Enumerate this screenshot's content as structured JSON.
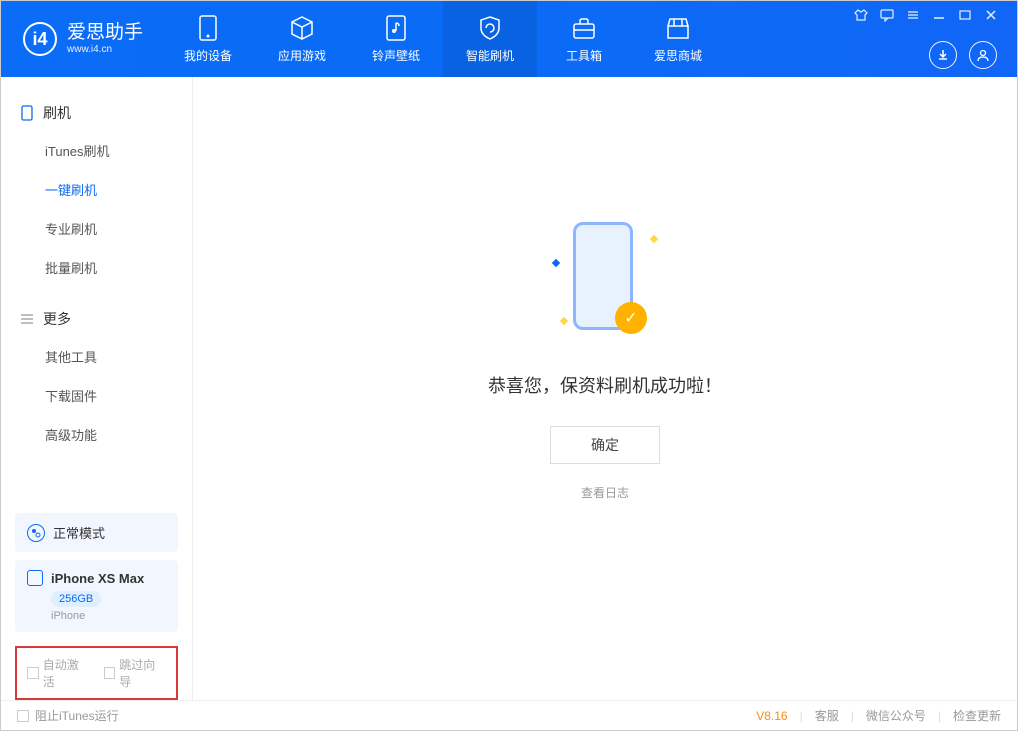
{
  "app": {
    "name": "爱思助手",
    "url": "www.i4.cn"
  },
  "nav": {
    "items": [
      {
        "label": "我的设备"
      },
      {
        "label": "应用游戏"
      },
      {
        "label": "铃声壁纸"
      },
      {
        "label": "智能刷机"
      },
      {
        "label": "工具箱"
      },
      {
        "label": "爱思商城"
      }
    ]
  },
  "sidebar": {
    "section1": {
      "title": "刷机"
    },
    "items1": [
      {
        "label": "iTunes刷机"
      },
      {
        "label": "一键刷机"
      },
      {
        "label": "专业刷机"
      },
      {
        "label": "批量刷机"
      }
    ],
    "section2": {
      "title": "更多"
    },
    "items2": [
      {
        "label": "其他工具"
      },
      {
        "label": "下载固件"
      },
      {
        "label": "高级功能"
      }
    ],
    "mode": "正常模式",
    "device": {
      "name": "iPhone XS Max",
      "storage": "256GB",
      "type": "iPhone"
    },
    "opts": {
      "auto_activate": "自动激活",
      "skip_guide": "跳过向导"
    }
  },
  "main": {
    "success": "恭喜您，保资料刷机成功啦！",
    "ok": "确定",
    "view_log": "查看日志"
  },
  "footer": {
    "block_itunes": "阻止iTunes运行",
    "version": "V8.16",
    "support": "客服",
    "wechat": "微信公众号",
    "update": "检查更新"
  }
}
